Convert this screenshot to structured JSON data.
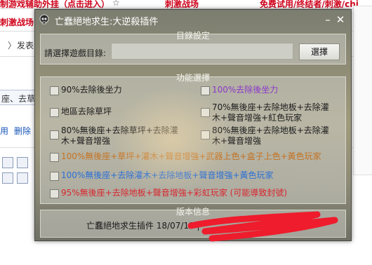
{
  "background": {
    "top_left_link": "制游戏辅助外挂（点击进入）",
    "top_star": "☆",
    "top_mid_link": "刺激战场",
    "top_right_link": "免费试用/终结者/刺激/chi",
    "left_link": "刺激战场★",
    "breadcrumb_arrow": "〉",
    "breadcrumb": "发表",
    "subject_fragment": "座、去草",
    "toolbar_links": [
      "用",
      "删除"
    ],
    "right_ad": "我爱辅助论"
  },
  "dialog": {
    "title": "亡蠢絕地求生:大逆殺插件",
    "minimize": "–",
    "close": "✕",
    "dir_group": {
      "legend": "目錄設定",
      "prompt": "請選擇遊戲目錄:",
      "path_value": "",
      "browse_label": "選擇"
    },
    "func_group": {
      "legend": "功能選擇",
      "options": [
        {
          "text": "90%去除後坐力",
          "color": "#1b1b1b",
          "checked": false
        },
        {
          "text": "100%去除後坐力",
          "color": "#8a38c8",
          "checked": false
        },
        {
          "text": "地區去除草坪",
          "color": "#1b1b1b",
          "checked": false
        },
        {
          "line1": "70%無後座+去除地板+去除灌",
          "line2": "木+聲音增強+紅色玩家",
          "color": "#1b1b1b",
          "checked": false
        },
        {
          "line1": "80%無後座+去除草坪+去除灌",
          "line2": "木+聲音增強",
          "color": "#1b1b1b",
          "checked": false
        },
        {
          "line1": "80%無後座+去除地板+去除灌",
          "line2": "木+聲音增強",
          "color": "#1b1b1b",
          "checked": false
        },
        {
          "text": "100%無後座+草坪+灌木+聲音增強+武器上色+盒子上色+黃色玩家",
          "color": "#c47222",
          "checked": false
        },
        {
          "text": "100%無後座+去除灌木+去除地板+聲音增強+黃色玩家",
          "color": "#2a6fd6",
          "checked": false
        },
        {
          "text": "95%無後座+去除地板+聲音增強+彩虹玩家 (可能導致封號)",
          "color": "#d8262e",
          "checked": false
        }
      ]
    },
    "version_group": {
      "legend": "版本信息",
      "info": "亡蠢絕地求生插件 18/07/11  |"
    }
  }
}
